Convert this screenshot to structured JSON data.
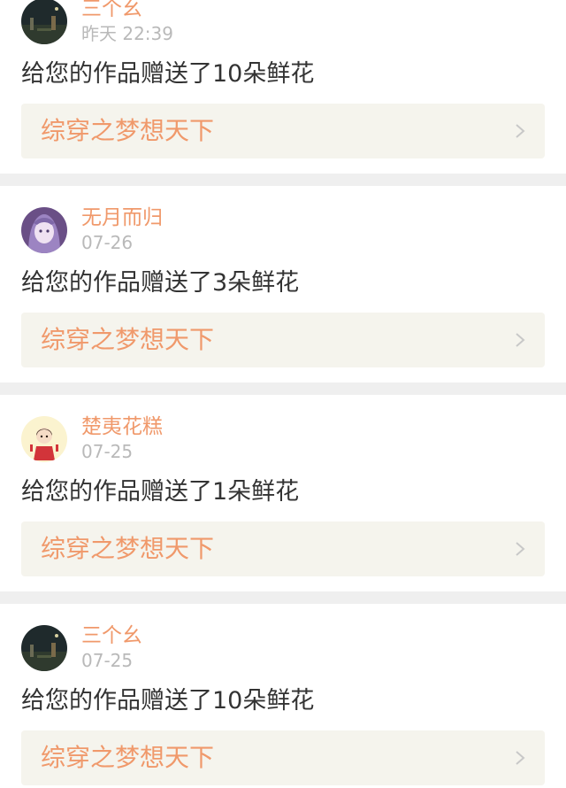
{
  "notifications": [
    {
      "username": "三个幺",
      "time": "昨天 22:39",
      "message": "给您的作品赠送了10朵鲜花",
      "work_title": "综穿之梦想天下",
      "avatar_icon": "night-scene-avatar"
    },
    {
      "username": "无月而归",
      "time": "07-26",
      "message": "给您的作品赠送了3朵鲜花",
      "work_title": "综穿之梦想天下",
      "avatar_icon": "anime-girl-purple-avatar"
    },
    {
      "username": "楚夷花糕",
      "time": "07-25",
      "message": "给您的作品赠送了1朵鲜花",
      "work_title": "综穿之梦想天下",
      "avatar_icon": "cartoon-girl-red-dress-avatar"
    },
    {
      "username": "三个幺",
      "time": "07-25",
      "message": "给您的作品赠送了10朵鲜花",
      "work_title": "综穿之梦想天下",
      "avatar_icon": "night-scene-avatar"
    }
  ],
  "colors": {
    "username": "#f0996b",
    "timestamp": "#b9b9b9",
    "message": "#333333",
    "work_link_bg": "#f5f4ed",
    "work_title": "#f0996b",
    "chevron": "#c8c8c8",
    "separator": "#efefef"
  }
}
